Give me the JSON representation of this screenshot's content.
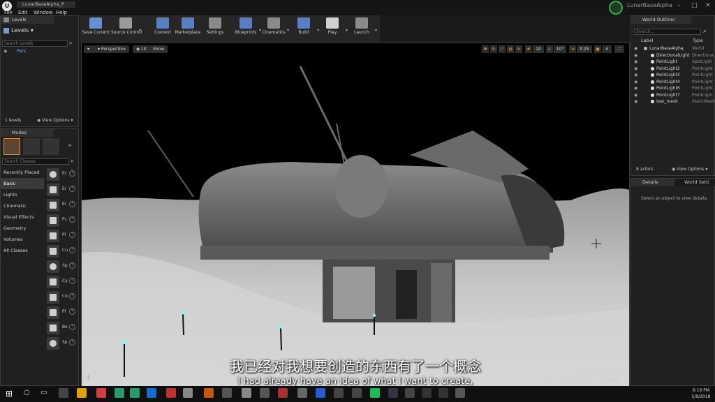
{
  "app": {
    "document_tab": "LunarBaseAlpha_P",
    "project_name": "LunarBaseAlpha",
    "menu": [
      "File",
      "Edit",
      "Window",
      "Help"
    ]
  },
  "toolbar": {
    "buttons": [
      {
        "label": "Save Current",
        "icon": "floppy-icon",
        "color": "#6a8fd0"
      },
      {
        "label": "Source Control",
        "icon": "source-control-icon",
        "color": "#9a9a9a"
      },
      {
        "label": "Content",
        "icon": "content-icon",
        "color": "#5a7fc0"
      },
      {
        "label": "Marketplace",
        "icon": "marketplace-icon",
        "color": "#5a7fc0"
      },
      {
        "label": "Settings",
        "icon": "gear-icon",
        "color": "#8a8a8a"
      },
      {
        "label": "Blueprints",
        "icon": "blueprint-icon",
        "color": "#5a7fc0"
      },
      {
        "label": "Cinematics",
        "icon": "clapper-icon",
        "color": "#8a8a8a"
      },
      {
        "label": "Build",
        "icon": "build-icon",
        "color": "#5a7fc0"
      },
      {
        "label": "Play",
        "icon": "play-icon",
        "color": "#d0d0d0"
      },
      {
        "label": "Launch",
        "icon": "gamepad-icon",
        "color": "#8a8a8a"
      }
    ]
  },
  "levels": {
    "tab": "Levels",
    "dropdown": "Levels",
    "search_placeholder": "Search Levels",
    "item": "Pers",
    "count": "1 levels",
    "view_options": "View Options"
  },
  "modes": {
    "tab": "Modes",
    "search_placeholder": "Search Classes",
    "categories": [
      "Recently Placed",
      "Basic",
      "Lights",
      "Cinematic",
      "Visual Effects",
      "Geometry",
      "Volumes",
      "All Classes"
    ],
    "selected_category": "Basic",
    "shapes": [
      {
        "label": "Er",
        "icon": "sphere-icon"
      },
      {
        "label": "Er",
        "icon": "character-icon"
      },
      {
        "label": "Er",
        "icon": "pawn-icon"
      },
      {
        "label": "Pc",
        "icon": "light-bulb-icon"
      },
      {
        "label": "Pl",
        "icon": "player-start-icon"
      },
      {
        "label": "Cu",
        "icon": "cube-icon"
      },
      {
        "label": "Sp",
        "icon": "sphere-icon"
      },
      {
        "label": "Cy",
        "icon": "cylinder-icon"
      },
      {
        "label": "Co",
        "icon": "cone-icon"
      },
      {
        "label": "Pl",
        "icon": "plane-icon"
      },
      {
        "label": "Bo",
        "icon": "box-trigger-icon"
      },
      {
        "label": "Sp",
        "icon": "sphere-trigger-icon"
      }
    ]
  },
  "viewport": {
    "perspective": "Perspective",
    "lit": "Lit",
    "show": "Show",
    "snap_values": [
      "10",
      "10°",
      "0.25",
      "4"
    ],
    "level_label": "Level:  LunarBaseAlpha_P (Persistent)",
    "subtitle_cn": "我已经对我想要创造的东西有了一个概念",
    "subtitle_en": "I had already have an idea of what I want to create,"
  },
  "outliner": {
    "tab": "World Outliner",
    "search_placeholder": "Search...",
    "columns": [
      "Label",
      "Type"
    ],
    "rows": [
      {
        "label": "LunarBaseAlpha_P",
        "type": "World"
      },
      {
        "label": "DirectionalLight",
        "type": "Directiona"
      },
      {
        "label": "PointLight",
        "type": "SpotLight"
      },
      {
        "label": "PointLight2",
        "type": "PointLight"
      },
      {
        "label": "PointLight3",
        "type": "PointLight"
      },
      {
        "label": "PointLight4",
        "type": "PointLight"
      },
      {
        "label": "PointLight6",
        "type": "PointLight"
      },
      {
        "label": "PointLight7",
        "type": "PointLight"
      },
      {
        "label": "test_mesh",
        "type": "StaticMesh"
      }
    ],
    "count": "8 actors",
    "view_options": "View Options"
  },
  "details": {
    "tab_details": "Details",
    "tab_world": "World Setti",
    "empty_text": "Select an object to view details."
  },
  "taskbar": {
    "time": "6:16 PM",
    "date": "5/9/2018"
  },
  "colors": {
    "accent": "#f0a030",
    "panel": "#202020",
    "project_ring": "#3ea84a"
  }
}
